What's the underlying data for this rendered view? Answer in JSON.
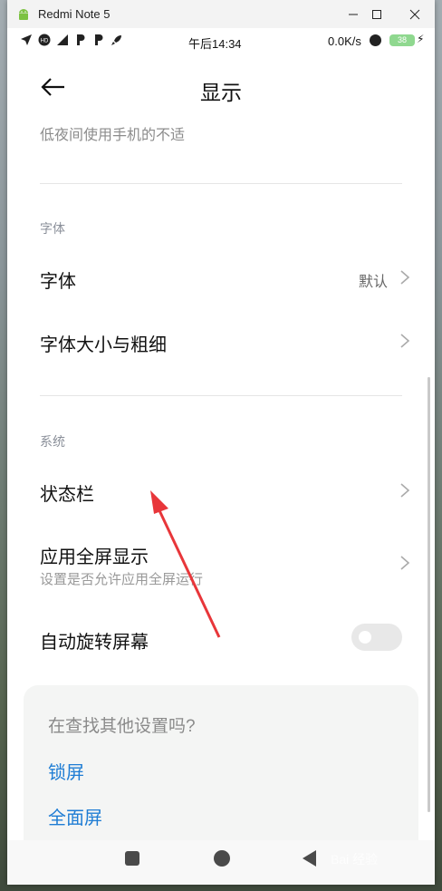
{
  "window": {
    "title": "Redmi Note 5",
    "min_icon": "minimize-icon",
    "max_icon": "maximize-icon",
    "close_icon": "close-icon"
  },
  "statusbar": {
    "time": "午后14:34",
    "speed": "0.0K/s",
    "battery": "38"
  },
  "header": {
    "title": "显示"
  },
  "top_desc": "低夜间使用手机的不适",
  "sections": {
    "font": "字体",
    "system": "系统"
  },
  "rows": {
    "font": {
      "label": "字体",
      "value": "默认"
    },
    "font_size": {
      "label": "字体大小与粗细"
    },
    "status_bar": {
      "label": "状态栏"
    },
    "fullscreen": {
      "label": "应用全屏显示",
      "sub": "设置是否允许应用全屏运行"
    },
    "auto_rotate": {
      "label": "自动旋转屏幕",
      "enabled": false
    }
  },
  "card": {
    "question": "在查找其他设置吗?",
    "links": [
      "锁屏",
      "全面屏"
    ]
  },
  "watermark": "Bai 经验",
  "colors": {
    "link": "#1f7dd4",
    "arrow": "#e8363a"
  }
}
